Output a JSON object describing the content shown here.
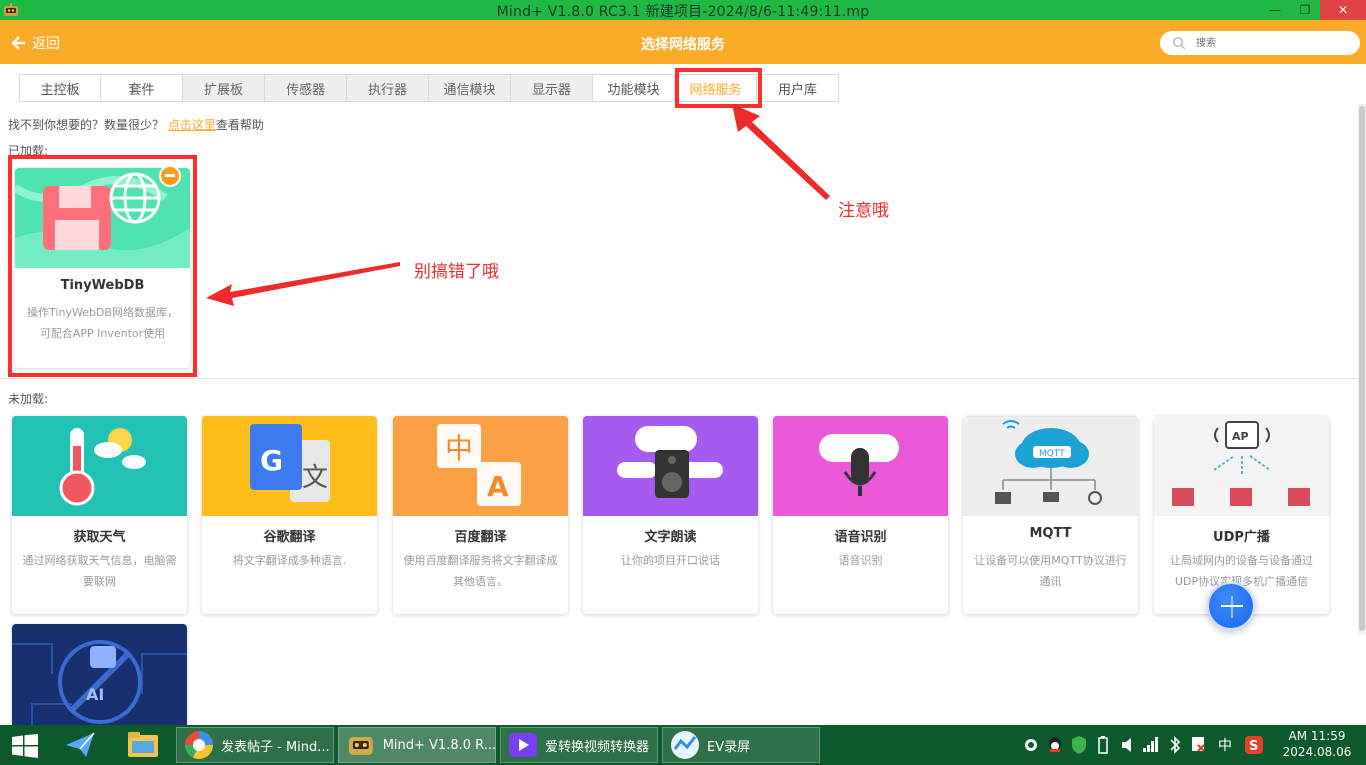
{
  "window": {
    "title": "Mind+ V1.8.0 RC3.1   新建项目-2024/8/6-11:49:11.mp",
    "minimize": "—",
    "maximize": "❐",
    "close": "✕"
  },
  "header": {
    "back_label": "返回",
    "title": "选择网络服务",
    "search_placeholder": "搜索"
  },
  "tabs": [
    {
      "label": "主控板",
      "style": "normal"
    },
    {
      "label": "套件",
      "style": "normal"
    },
    {
      "label": "扩展板",
      "style": "gray"
    },
    {
      "label": "传感器",
      "style": "gray"
    },
    {
      "label": "执行器",
      "style": "gray"
    },
    {
      "label": "通信模块",
      "style": "gray"
    },
    {
      "label": "显示器",
      "style": "gray"
    },
    {
      "label": "功能模块",
      "style": "normal"
    },
    {
      "label": "网络服务",
      "style": "active"
    },
    {
      "label": "用户库",
      "style": "normal"
    }
  ],
  "help": {
    "prefix": "找不到你想要的？数量很少？ ",
    "link": "点击这里",
    "suffix": "查看帮助"
  },
  "loaded": {
    "label": "已加载:",
    "cards": [
      {
        "title": "TinyWebDB",
        "desc": "操作TinyWebDB网络数据库，可配合APP Inventor使用"
      }
    ]
  },
  "unloaded": {
    "label": "未加载:",
    "cards": [
      {
        "title": "获取天气",
        "desc": "通过网络获取天气信息，电脑需要联网"
      },
      {
        "title": "谷歌翻译",
        "desc": "将文字翻译成多种语言."
      },
      {
        "title": "百度翻译",
        "desc": "使用百度翻译服务将文字翻译成其他语言。"
      },
      {
        "title": "文字朗读",
        "desc": "让你的项目开口说话"
      },
      {
        "title": "语音识别",
        "desc": "语音识别"
      },
      {
        "title": "MQTT",
        "desc": "让设备可以使用MQTT协议进行通讯"
      },
      {
        "title": "UDP广播",
        "desc": "让局域网内的设备与设备通过UDP协议实现多机广播通信"
      }
    ]
  },
  "annotations": {
    "note1": "注意哦",
    "note2": "别搞错了哦"
  },
  "taskbar": {
    "windows": [
      {
        "label": "发表帖子 - Mind..."
      },
      {
        "label": "Mind+ V1.8.0 R..."
      },
      {
        "label": "爱转换视频转换器"
      },
      {
        "label": "EV录屏"
      }
    ],
    "ime": "中",
    "time": "AM 11:59",
    "date": "2024.08.06"
  },
  "colors": {
    "titlebar": "#1fb845",
    "header": "#fcab29",
    "accent_red": "#ff2e2e",
    "taskbar": "#0c5a2c"
  }
}
